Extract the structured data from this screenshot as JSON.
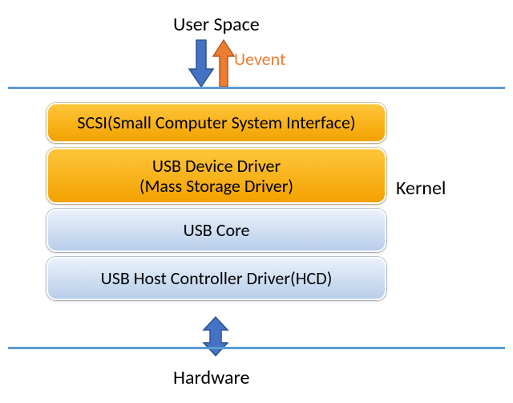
{
  "labels": {
    "user_space": "User Space",
    "uevent": "Uevent",
    "kernel": "Kernel",
    "hardware": "Hardware"
  },
  "layers": {
    "scsi": "SCSI(Small Computer System Interface)",
    "usb_driver_l1": "USB Device Driver",
    "usb_driver_l2": "(Mass Storage Driver)",
    "usb_core": "USB Core",
    "hcd": "USB Host Controller Driver(HCD)"
  },
  "colors": {
    "line": "#5B9BD5",
    "accent": "#ED7D31",
    "orange_fill": "#F7A600",
    "blue_fill": "#D9E6F5"
  }
}
